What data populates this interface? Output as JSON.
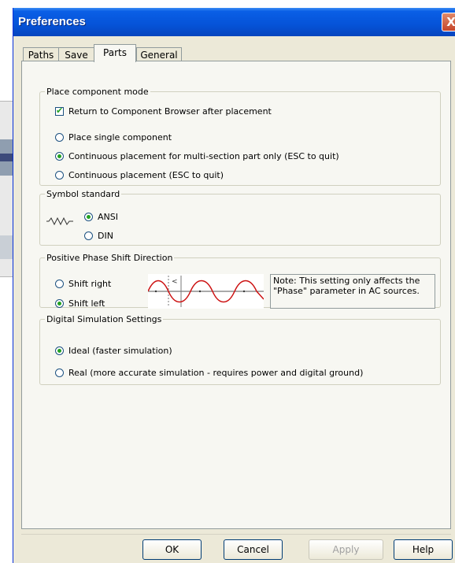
{
  "window": {
    "title": "Preferences",
    "close_glyph": "X"
  },
  "tabs": [
    {
      "label": "Paths",
      "active": false
    },
    {
      "label": "Save",
      "active": false
    },
    {
      "label": "Parts",
      "active": true
    },
    {
      "label": "General",
      "active": false
    }
  ],
  "place_component": {
    "legend": "Place component mode",
    "return_checkbox": {
      "label": "Return to Component Browser after placement",
      "checked": true
    },
    "options": [
      {
        "label": "Place single component",
        "selected": false
      },
      {
        "label": "Continuous placement for multi-section part only (ESC to quit)",
        "selected": true
      },
      {
        "label": "Continuous placement (ESC to quit)",
        "selected": false
      }
    ]
  },
  "symbol_standard": {
    "legend": "Symbol standard",
    "options": [
      {
        "label": "ANSI",
        "selected": true
      },
      {
        "label": "DIN",
        "selected": false
      }
    ]
  },
  "phase_shift": {
    "legend": "Positive Phase Shift Direction",
    "options": [
      {
        "label": "Shift right",
        "selected": false
      },
      {
        "label": "Shift left",
        "selected": true
      }
    ],
    "note": "Note: This setting only affects the \"Phase\" parameter in AC sources."
  },
  "digital_sim": {
    "legend": "Digital Simulation Settings",
    "options": [
      {
        "label": "Ideal (faster simulation)",
        "selected": true
      },
      {
        "label": "Real (more accurate simulation - requires power and digital ground)",
        "selected": false
      }
    ]
  },
  "buttons": {
    "ok": "OK",
    "cancel": "Cancel",
    "apply": "Apply",
    "help": "Help"
  },
  "colors": {
    "titlebar": "#0553d8",
    "radio_dot": "#21a121",
    "face": "#ece9d8",
    "panel": "#f7f7f2"
  }
}
